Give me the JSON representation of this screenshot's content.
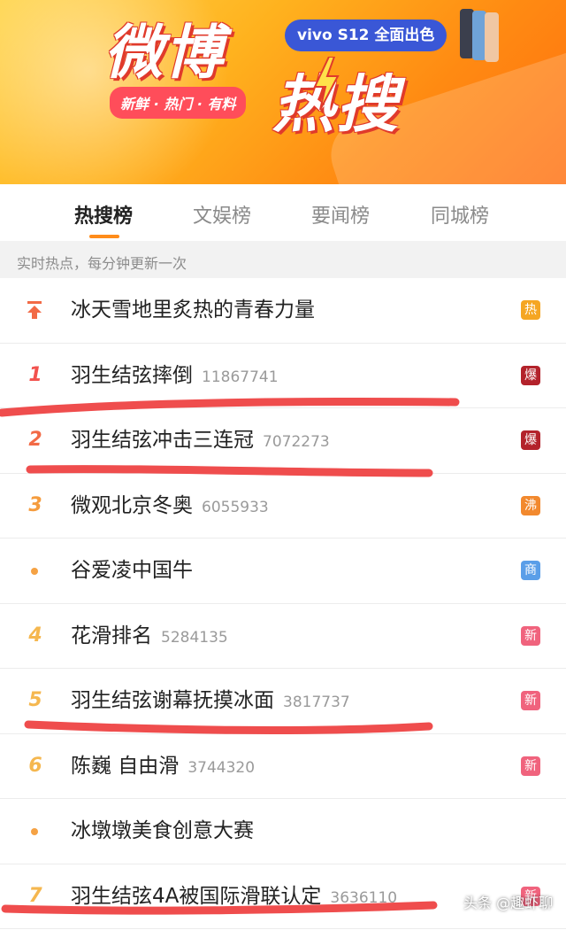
{
  "banner": {
    "title_part1": "微博",
    "title_part2": "热搜",
    "slogan": "新鲜 · 热门 · 有料",
    "ad_text": "vivo S12 全面出色",
    "colors": {
      "accent": "#ff8c1a",
      "title_outline": "#e03a2b",
      "ad_bg": "#3a57d6"
    }
  },
  "tabs": [
    {
      "label": "热搜榜",
      "active": true
    },
    {
      "label": "文娱榜",
      "active": false
    },
    {
      "label": "要闻榜",
      "active": false
    },
    {
      "label": "同城榜",
      "active": false
    }
  ],
  "subheader": "实时热点，每分钟更新一次",
  "items": [
    {
      "rank": "",
      "marker": "pin-icon",
      "title": "冰天雪地里炙热的青春力量",
      "count": "",
      "badge": "热",
      "badge_color": "#f5a623"
    },
    {
      "rank": "1",
      "marker": "",
      "title": "羽生结弦摔倒",
      "count": "11867741",
      "badge": "爆",
      "badge_color": "#b3222b"
    },
    {
      "rank": "2",
      "marker": "",
      "title": "羽生结弦冲击三连冠",
      "count": "7072273",
      "badge": "爆",
      "badge_color": "#b3222b"
    },
    {
      "rank": "3",
      "marker": "",
      "title": "微观北京冬奥",
      "count": "6055933",
      "badge": "沸",
      "badge_color": "#f2892e"
    },
    {
      "rank": "",
      "marker": "dot",
      "title": "谷爱凌中国牛",
      "count": "",
      "badge": "商",
      "badge_color": "#5a9ee8"
    },
    {
      "rank": "4",
      "marker": "",
      "title": "花滑排名",
      "count": "5284135",
      "badge": "新",
      "badge_color": "#f0637d"
    },
    {
      "rank": "5",
      "marker": "",
      "title": "羽生结弦谢幕抚摸冰面",
      "count": "3817737",
      "badge": "新",
      "badge_color": "#f0637d"
    },
    {
      "rank": "6",
      "marker": "",
      "title": "陈巍 自由滑",
      "count": "3744320",
      "badge": "新",
      "badge_color": "#f0637d"
    },
    {
      "rank": "",
      "marker": "dot",
      "title": "冰墩墩美食创意大赛",
      "count": "",
      "badge": "",
      "badge_color": ""
    },
    {
      "rank": "7",
      "marker": "",
      "title": "羽生结弦4A被国际滑联认定",
      "count": "3636110",
      "badge": "新",
      "badge_color": "#f0637d"
    }
  ],
  "watermark": "头条 @趣虾聊"
}
